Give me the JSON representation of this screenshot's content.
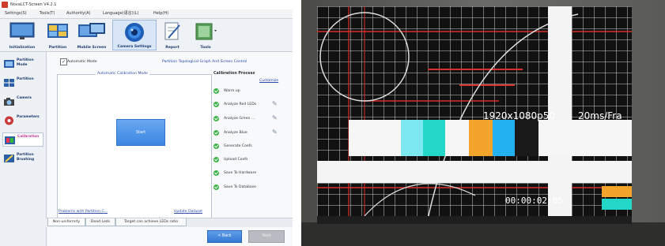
{
  "window": {
    "title": "NovaLCT-Screen V4.2.1",
    "menu": [
      "Settings(S)",
      "Tools(T)",
      "Authority(A)",
      "Language(语言)(L)",
      "Help(H)"
    ]
  },
  "toolbar": {
    "items": [
      {
        "label": "Initialization",
        "icon": "monitor-icon"
      },
      {
        "label": "Partition",
        "icon": "partition-icon"
      },
      {
        "label": "Mobile Screen",
        "icon": "mobile-screen-icon"
      },
      {
        "label": "Camera Settings",
        "icon": "camera-lens-icon"
      },
      {
        "label": "Report",
        "icon": "report-icon"
      },
      {
        "label": "Tools",
        "icon": "tools-icon"
      }
    ]
  },
  "sidebar": {
    "items": [
      {
        "label": "Partition Mode"
      },
      {
        "label": "Partition"
      },
      {
        "label": "Camera"
      },
      {
        "label": "Parameters"
      },
      {
        "label": "Calibration"
      },
      {
        "label": "Partition Brushing"
      }
    ]
  },
  "content": {
    "auto_mode_label": "Automatic Mode",
    "auto_mode_checked": true,
    "control_link": "Partition Topological Graph And Screen Control",
    "group_title": "Automatic Calibration Mode",
    "start_label": "Start",
    "process_title": "Calibration Process",
    "customize_label": "Customize",
    "steps": [
      "Warm up",
      "Analyze Red LEDs",
      "Analyze Green ...",
      "Analyze Blue",
      "Generate Coefs",
      "Upload Coefs",
      "Save To Hardware",
      "Save To Database"
    ],
    "problems_link": "Problems with Partition C...",
    "update_link": "Update Dataset"
  },
  "tabs": [
    "Non-uniformity",
    "Dead Leds",
    "Target can achieve LEDs ratio"
  ],
  "buttons": {
    "back": "< Back",
    "next": "Next"
  },
  "photo": {
    "resolution_text": "1920x1080p50",
    "frame_rate_text": "20ms/Fra",
    "timecode_text": "00:00:02:05"
  },
  "colors": {
    "accent": "#3b86e2",
    "progress_green": "#3eb34a",
    "link": "#2a4aa8"
  }
}
